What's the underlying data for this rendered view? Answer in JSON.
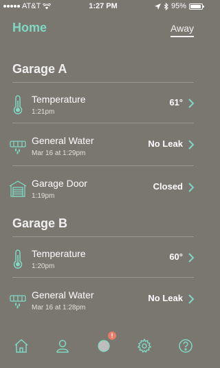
{
  "status": {
    "carrier": "AT&T",
    "time": "1:27 PM",
    "battery": "95%",
    "battery_level": 0.95
  },
  "header": {
    "title": "Home",
    "away_tab": "Away"
  },
  "sections": [
    {
      "title": "Garage A",
      "rows": [
        {
          "icon": "thermometer-icon",
          "label": "Temperature",
          "sub": "1:21pm",
          "value": "61°"
        },
        {
          "icon": "water-sensor-icon",
          "label": "General Water",
          "sub": "Mar 16 at 1:29pm",
          "value": "No Leak"
        },
        {
          "icon": "garage-door-icon",
          "label": "Garage Door",
          "sub": "1:19pm",
          "value": "Closed"
        }
      ]
    },
    {
      "title": "Garage B",
      "rows": [
        {
          "icon": "thermometer-icon",
          "label": "Temperature",
          "sub": "1:20pm",
          "value": "60°"
        },
        {
          "icon": "water-sensor-icon",
          "label": "General Water",
          "sub": "Mar 16 at 1:28pm",
          "value": "No Leak"
        }
      ]
    }
  ],
  "tabbar": {
    "items": [
      "home-icon",
      "user-icon",
      "alerts-icon",
      "settings-icon",
      "help-icon"
    ],
    "badge": "!"
  },
  "colors": {
    "background": "#7a7670",
    "accent": "#7fd9c2",
    "badge": "#e77c68"
  }
}
